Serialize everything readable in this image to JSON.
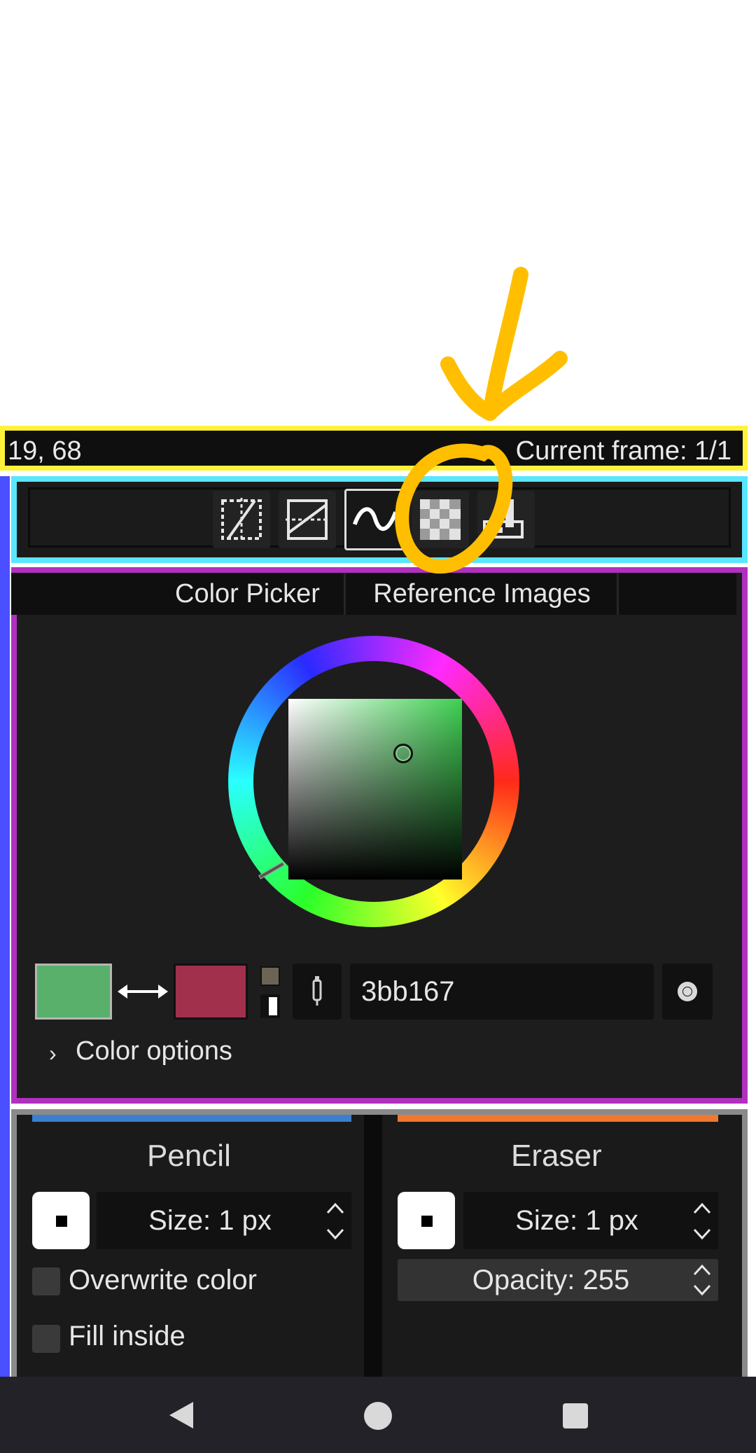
{
  "status": {
    "coords": "19, 68",
    "frame": "Current frame: 1/1"
  },
  "toolbar": {
    "buttons": [
      "mirror-horizontal-icon",
      "mirror-vertical-icon",
      "pixel-perfect-icon",
      "alpha-lock-icon",
      "draw-on-selection-icon"
    ],
    "active": "pixel-perfect-icon"
  },
  "tabs": [
    "Color Picker",
    "Reference Images"
  ],
  "color_picker": {
    "hex": "3bb167",
    "primary_color": "#58b06b",
    "secondary_color": "#a0304b",
    "options_label": "Color options"
  },
  "tools": {
    "left": {
      "title": "Pencil",
      "size": "Size: 1 px",
      "overwrite": "Overwrite color",
      "fill": "Fill inside",
      "color": "#3a7fd0"
    },
    "right": {
      "title": "Eraser",
      "size": "Size: 1 px",
      "opacity": "Opacity: 255",
      "color": "#f07830"
    }
  },
  "annotation_color": "#ffbf00"
}
